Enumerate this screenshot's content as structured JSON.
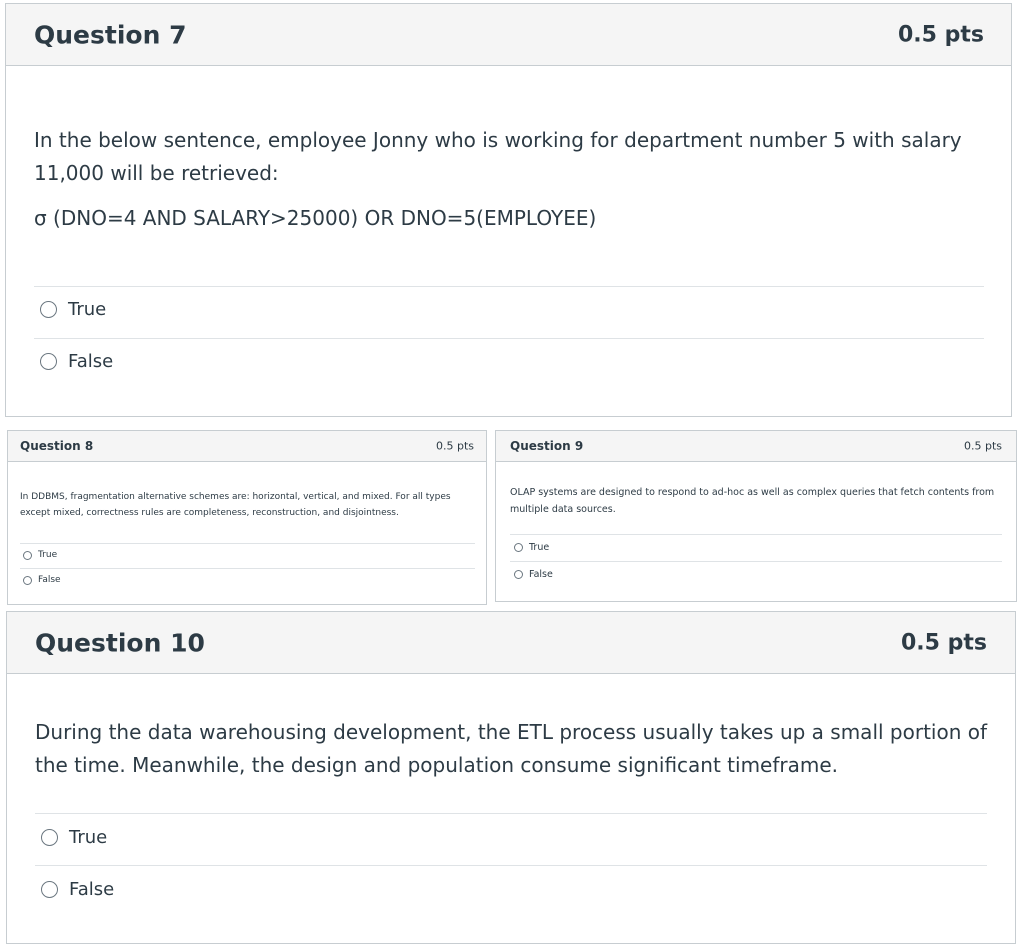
{
  "questions": {
    "q7": {
      "title": "Question 7",
      "points": "0.5 pts",
      "stem": "In the below sentence, employee Jonny who is working for department number 5 with salary 11,000 will be retrieved:",
      "formula": "σ (DNO=4 AND SALARY>25000) OR DNO=5(EMPLOYEE)",
      "options": [
        "True",
        "False"
      ],
      "selected": null
    },
    "q8": {
      "title": "Question 8",
      "points": "0.5 pts",
      "stem": "In DDBMS, fragmentation alternative schemes are: horizontal, vertical, and mixed. For all types except mixed, correctness rules are completeness, reconstruction, and disjointness.",
      "options": [
        "True",
        "False"
      ],
      "selected": null
    },
    "q9": {
      "title": "Question 9",
      "points": "0.5 pts",
      "stem": "OLAP systems are designed to respond to ad-hoc as well as complex queries that fetch contents from multiple data sources.",
      "options": [
        "True",
        "False"
      ],
      "selected": null
    },
    "q10": {
      "title": "Question 10",
      "points": "0.5 pts",
      "stem": "During the data warehousing development, the ETL process usually takes up a small portion of the time. Meanwhile, the design and population consume significant timeframe.",
      "options": [
        "True",
        "False"
      ],
      "selected": null
    }
  }
}
